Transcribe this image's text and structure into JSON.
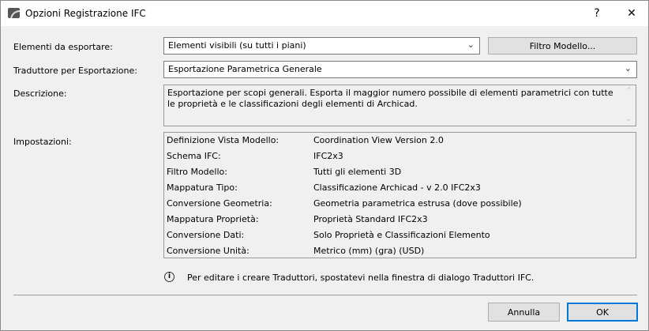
{
  "window": {
    "title": "Opzioni Registrazione IFC",
    "help": "?",
    "close": "✕"
  },
  "form": {
    "export_label": "Elementi da esportare:",
    "export_value": "Elementi visibili (su tutti i piani)",
    "filter_button": "Filtro Modello...",
    "translator_label": "Traduttore per Esportazione:",
    "translator_value": "Esportazione Parametrica Generale",
    "description_label": "Descrizione:",
    "description": "Esportazione per scopi generali. Esporta il maggior numero possibile di elementi parametrici con tutte le proprietà e le classificazioni degli elementi di Archicad.",
    "settings_label": "Impostazioni:"
  },
  "settings": [
    {
      "key": "Definizione Vista Modello:",
      "value": "Coordination View Version 2.0"
    },
    {
      "key": "Schema IFC:",
      "value": "IFC2x3"
    },
    {
      "key": "Filtro Modello:",
      "value": "Tutti gli elementi 3D"
    },
    {
      "key": "Mappatura Tipo:",
      "value": "Classificazione Archicad - v 2.0 IFC2x3"
    },
    {
      "key": "Conversione Geometria:",
      "value": "Geometria parametrica estrusa (dove possibile)"
    },
    {
      "key": "Mappatura Proprietà:",
      "value": "Proprietà Standard IFC2x3"
    },
    {
      "key": "Conversione Dati:",
      "value": "Solo Proprietà e Classificazioni Elemento"
    },
    {
      "key": "Conversione Unità:",
      "value": "Metrico (mm) (gra) (USD)"
    }
  ],
  "info_text": "Per editare i creare Traduttori, spostatevi nella finestra di dialogo Traduttori IFC.",
  "buttons": {
    "cancel": "Annulla",
    "ok": "OK"
  }
}
